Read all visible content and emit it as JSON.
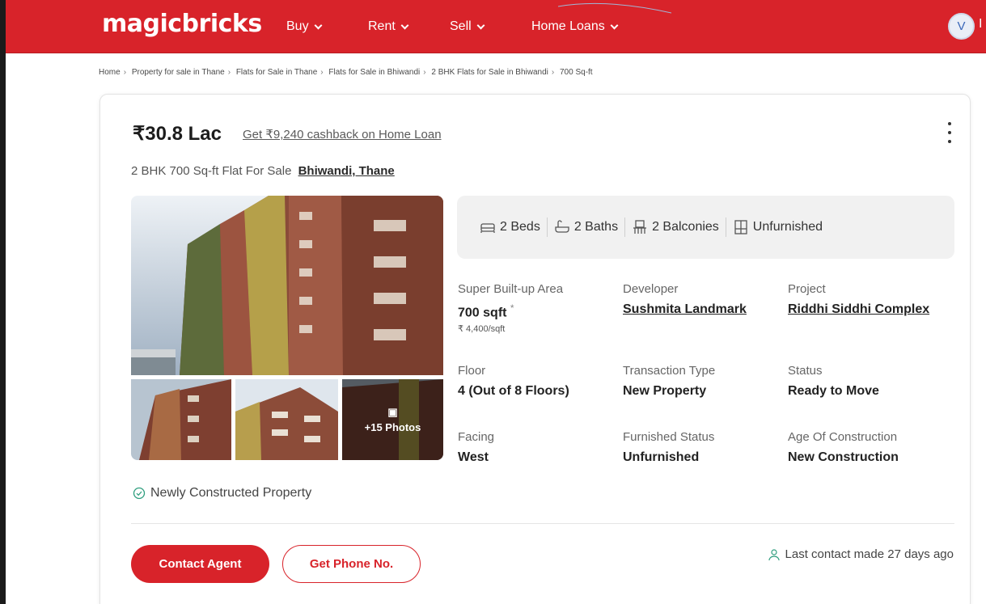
{
  "brand": {
    "logo": "magicbricks",
    "accent": "#d8232a"
  },
  "nav": {
    "items": [
      {
        "label": "Buy"
      },
      {
        "label": "Rent"
      },
      {
        "label": "Sell"
      },
      {
        "label": "Home Loans"
      }
    ],
    "avatar_letter": "V",
    "avatar_tail": "I"
  },
  "breadcrumb": [
    "Home",
    "Property for sale in Thane",
    "Flats for Sale in Thane",
    "Flats for Sale in Bhiwandi",
    "2 BHK Flats for Sale in Bhiwandi",
    "700 Sq-ft"
  ],
  "listing": {
    "price": "₹30.8 Lac",
    "cashback": "Get ₹9,240 cashback on Home Loan",
    "subtitle": "2 BHK 700 Sq-ft Flat For Sale",
    "location": "Bhiwandi, Thane",
    "photo_overlay": "+15 Photos",
    "summary": {
      "beds": "2 Beds",
      "baths": "2 Baths",
      "balconies": "2 Balconies",
      "furnishing": "Unfurnished"
    },
    "details": {
      "area_label": "Super Built-up Area",
      "area_value": "700 sqft",
      "area_marker": "*",
      "area_rate": "₹ 4,400/sqft",
      "developer_label": "Developer",
      "developer_value": "Sushmita Landmark",
      "project_label": "Project",
      "project_value": "Riddhi Siddhi Complex",
      "floor_label": "Floor",
      "floor_value": "4 (Out of 8 Floors)",
      "transaction_label": "Transaction Type",
      "transaction_value": "New Property",
      "status_label": "Status",
      "status_value": "Ready to Move",
      "facing_label": "Facing",
      "facing_value": "West",
      "furnished_label": "Furnished Status",
      "furnished_value": "Unfurnished",
      "age_label": "Age Of Construction",
      "age_value": "New Construction"
    },
    "newly_constructed": "Newly Constructed Property",
    "contact_agent": "Contact Agent",
    "get_phone": "Get Phone No.",
    "last_contact": "Last contact made 27 days ago"
  }
}
